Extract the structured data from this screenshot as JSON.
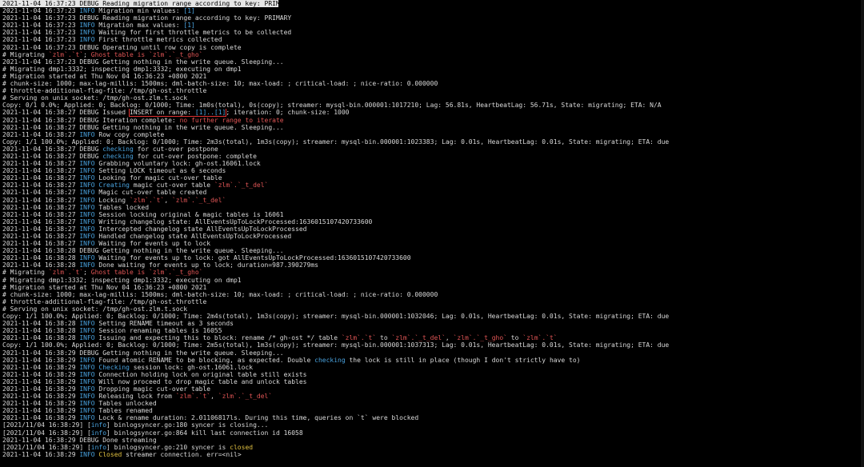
{
  "colors": {
    "background": "#000000",
    "text": "#d9d9d9",
    "info": "#4aa3df",
    "accent_red": "#e05555",
    "closed": "#e0c040"
  },
  "lines": [
    {
      "hl": true,
      "segs": [
        {
          "t": "2021-11-04 16:37:23 DEBUG Reading migration range according to key: PRIMARY"
        }
      ]
    },
    {
      "segs": [
        {
          "t": "2021-11-04 16:37:23 "
        },
        {
          "t": "INFO",
          "c": "blue"
        },
        {
          "t": " Migration min values: "
        },
        {
          "t": "[1]",
          "c": "blue"
        }
      ]
    },
    {
      "segs": [
        {
          "t": "2021-11-04 16:37:23 DEBUG Reading migration range according to key: PRIMARY"
        }
      ]
    },
    {
      "segs": [
        {
          "t": "2021-11-04 16:37:23 "
        },
        {
          "t": "INFO",
          "c": "blue"
        },
        {
          "t": " Migration max values: "
        },
        {
          "t": "[1]",
          "c": "blue"
        }
      ]
    },
    {
      "segs": [
        {
          "t": "2021-11-04 16:37:23 "
        },
        {
          "t": "INFO",
          "c": "blue"
        },
        {
          "t": " Waiting for first throttle metrics to be collected"
        }
      ]
    },
    {
      "segs": [
        {
          "t": "2021-11-04 16:37:23 "
        },
        {
          "t": "INFO",
          "c": "blue"
        },
        {
          "t": " First throttle metrics collected"
        }
      ]
    },
    {
      "segs": [
        {
          "t": "2021-11-04 16:37:23 DEBUG Operating until row copy is complete"
        }
      ]
    },
    {
      "segs": [
        {
          "t": "# Migrating "
        },
        {
          "t": "`zlm`.`t`",
          "c": "red"
        },
        {
          "t": "; "
        },
        {
          "t": "Ghost table is",
          "c": "red"
        },
        {
          "t": " "
        },
        {
          "t": "`zlm`.`_t_gho`",
          "c": "red"
        }
      ]
    },
    {
      "segs": [
        {
          "t": "2021-11-04 16:37:23 DEBUG Getting nothing in the write queue. Sleeping..."
        }
      ]
    },
    {
      "segs": [
        {
          "t": "# Migrating dmp1:3332; inspecting dmp1:3332; executing on dmp1"
        }
      ]
    },
    {
      "segs": [
        {
          "t": "# Migration started at Thu Nov 04 16:36:23 +0800 2021"
        }
      ]
    },
    {
      "segs": [
        {
          "t": "# chunk-size: 1000; max-lag-millis: 1500ms; dml-batch-size: 10; max-load: ; critical-load: ; nice-ratio: 0.000000"
        }
      ]
    },
    {
      "segs": [
        {
          "t": "# throttle-additional-flag-file: /tmp/gh-ost.throttle"
        }
      ]
    },
    {
      "segs": [
        {
          "t": "# Serving on unix socket: /tmp/gh-ost.zlm.t.sock"
        }
      ]
    },
    {
      "segs": [
        {
          "t": "Copy: 0/1 0.0%; Applied: 0; Backlog: 0/1000; Time: 1m0s(total), 0s(copy); streamer: mysql-bin.000001:1017210; Lag: 56.81s, HeartbeatLag: 56.71s, State: migrating; ETA: N/A"
        }
      ]
    },
    {
      "segs": [
        {
          "t": "2021-11-04 16:38:27 DEBUG Issued "
        },
        {
          "t": "INSERT on range: ",
          "b": true
        },
        {
          "t": "[1]..[1]",
          "c": "blue",
          "b": true
        },
        {
          "t": "; iteration: 0; chunk-size: 1000"
        }
      ]
    },
    {
      "segs": [
        {
          "t": "2021-11-04 16:38:27 DEBUG Iteration complete: "
        },
        {
          "t": "no further range to iterate",
          "c": "red"
        }
      ]
    },
    {
      "segs": [
        {
          "t": "2021-11-04 16:38:27 DEBUG Getting nothing in the write queue. Sleeping..."
        }
      ]
    },
    {
      "segs": [
        {
          "t": "2021-11-04 16:38:27 "
        },
        {
          "t": "INFO",
          "c": "blue"
        },
        {
          "t": " Row copy complete"
        }
      ]
    },
    {
      "segs": [
        {
          "t": "Copy: 1/1 100.0%; Applied: 0; Backlog: 0/1000; Time: 2m3s(total), 1m3s(copy); streamer: mysql-bin.000001:1023383; Lag: 0.01s, HeartbeatLag: 0.01s, State: migrating; ETA: due"
        }
      ]
    },
    {
      "segs": [
        {
          "t": "2021-11-04 16:38:27 DEBUG "
        },
        {
          "t": "checking",
          "c": "blue"
        },
        {
          "t": " for cut-over postpone"
        }
      ]
    },
    {
      "segs": [
        {
          "t": "2021-11-04 16:38:27 DEBUG "
        },
        {
          "t": "checking",
          "c": "blue"
        },
        {
          "t": " for cut-over postpone: complete"
        }
      ]
    },
    {
      "segs": [
        {
          "t": "2021-11-04 16:38:27 "
        },
        {
          "t": "INFO",
          "c": "blue"
        },
        {
          "t": " Grabbing voluntary lock: gh-ost.16061.lock"
        }
      ]
    },
    {
      "segs": [
        {
          "t": "2021-11-04 16:38:27 "
        },
        {
          "t": "INFO",
          "c": "blue"
        },
        {
          "t": " Setting LOCK timeout as 6 seconds"
        }
      ]
    },
    {
      "segs": [
        {
          "t": "2021-11-04 16:38:27 "
        },
        {
          "t": "INFO",
          "c": "blue"
        },
        {
          "t": " Looking for magic cut-over table"
        }
      ]
    },
    {
      "segs": [
        {
          "t": "2021-11-04 16:38:27 "
        },
        {
          "t": "INFO",
          "c": "blue"
        },
        {
          "t": " "
        },
        {
          "t": "Creating",
          "c": "blue"
        },
        {
          "t": " magic cut-over table "
        },
        {
          "t": "`zlm`.`_t_del`",
          "c": "red"
        }
      ]
    },
    {
      "segs": [
        {
          "t": "2021-11-04 16:38:27 "
        },
        {
          "t": "INFO",
          "c": "blue"
        },
        {
          "t": " Magic cut-over table created"
        }
      ]
    },
    {
      "segs": [
        {
          "t": "2021-11-04 16:38:27 "
        },
        {
          "t": "INFO",
          "c": "blue"
        },
        {
          "t": " Locking "
        },
        {
          "t": "`zlm`.`t`",
          "c": "red"
        },
        {
          "t": ", "
        },
        {
          "t": "`zlm`.`_t_del`",
          "c": "red"
        }
      ]
    },
    {
      "segs": [
        {
          "t": "2021-11-04 16:38:27 "
        },
        {
          "t": "INFO",
          "c": "blue"
        },
        {
          "t": " Tables locked"
        }
      ]
    },
    {
      "segs": [
        {
          "t": "2021-11-04 16:38:27 "
        },
        {
          "t": "INFO",
          "c": "blue"
        },
        {
          "t": " Session locking original & magic tables is 16061"
        }
      ]
    },
    {
      "segs": [
        {
          "t": "2021-11-04 16:38:27 "
        },
        {
          "t": "INFO",
          "c": "blue"
        },
        {
          "t": " Writing changelog state: AllEventsUpToLockProcessed:1636015107420733600"
        }
      ]
    },
    {
      "segs": [
        {
          "t": "2021-11-04 16:38:27 "
        },
        {
          "t": "INFO",
          "c": "blue"
        },
        {
          "t": " Intercepted changelog state AllEventsUpToLockProcessed"
        }
      ]
    },
    {
      "segs": [
        {
          "t": "2021-11-04 16:38:27 "
        },
        {
          "t": "INFO",
          "c": "blue"
        },
        {
          "t": " Handled changelog state AllEventsUpToLockProcessed"
        }
      ]
    },
    {
      "segs": [
        {
          "t": "2021-11-04 16:38:27 "
        },
        {
          "t": "INFO",
          "c": "blue"
        },
        {
          "t": " Waiting for events up to lock"
        }
      ]
    },
    {
      "segs": [
        {
          "t": "2021-11-04 16:38:28 DEBUG Getting nothing in the write queue. Sleeping..."
        }
      ]
    },
    {
      "segs": [
        {
          "t": "2021-11-04 16:38:28 "
        },
        {
          "t": "INFO",
          "c": "blue"
        },
        {
          "t": " Waiting for events up to lock: got AllEventsUpToLockProcessed:1636015107420733600"
        }
      ]
    },
    {
      "segs": [
        {
          "t": "2021-11-04 16:38:28 "
        },
        {
          "t": "INFO",
          "c": "blue"
        },
        {
          "t": " Done waiting for events up to lock; duration=987.390279ms"
        }
      ]
    },
    {
      "segs": [
        {
          "t": "# Migrating "
        },
        {
          "t": "`zlm`.`t`",
          "c": "red"
        },
        {
          "t": "; "
        },
        {
          "t": "Ghost table is",
          "c": "red"
        },
        {
          "t": " "
        },
        {
          "t": "`zlm`.`_t_gho`",
          "c": "red"
        }
      ]
    },
    {
      "segs": [
        {
          "t": "# Migrating dmp1:3332; inspecting dmp1:3332; executing on dmp1"
        }
      ]
    },
    {
      "segs": [
        {
          "t": "# Migration started at Thu Nov 04 16:36:23 +0800 2021"
        }
      ]
    },
    {
      "segs": [
        {
          "t": "# chunk-size: 1000; max-lag-millis: 1500ms; dml-batch-size: 10; max-load: ; critical-load: ; nice-ratio: 0.000000"
        }
      ]
    },
    {
      "segs": [
        {
          "t": "# throttle-additional-flag-file: /tmp/gh-ost.throttle"
        }
      ]
    },
    {
      "segs": [
        {
          "t": "# Serving on unix socket: /tmp/gh-ost.zlm.t.sock"
        }
      ]
    },
    {
      "segs": [
        {
          "t": "Copy: 1/1 100.0%; Applied: 0; Backlog: 0/1000; Time: 2m4s(total), 1m3s(copy); streamer: mysql-bin.000001:1032046; Lag: 0.01s, HeartbeatLag: 0.01s, State: migrating; ETA: due"
        }
      ]
    },
    {
      "segs": [
        {
          "t": "2021-11-04 16:38:28 "
        },
        {
          "t": "INFO",
          "c": "blue"
        },
        {
          "t": " Setting RENAME timeout as 3 seconds"
        }
      ]
    },
    {
      "segs": [
        {
          "t": "2021-11-04 16:38:28 "
        },
        {
          "t": "INFO",
          "c": "blue"
        },
        {
          "t": " Session renaming tables is 16055"
        }
      ]
    },
    {
      "segs": [
        {
          "t": "2021-11-04 16:38:28 "
        },
        {
          "t": "INFO",
          "c": "blue"
        },
        {
          "t": " Issuing and expecting this to block: rename /* gh-ost */ table "
        },
        {
          "t": "`zlm`.`t`",
          "c": "red"
        },
        {
          "t": " to "
        },
        {
          "t": "`zlm`.`_t_del`",
          "c": "red"
        },
        {
          "t": ", "
        },
        {
          "t": "`zlm`.`_t_gho`",
          "c": "red"
        },
        {
          "t": " to "
        },
        {
          "t": "`zlm`.`t`",
          "c": "red"
        }
      ]
    },
    {
      "segs": [
        {
          "t": "Copy: 1/1 100.0%; Applied: 0; Backlog: 0/1000; Time: 2m5s(total), 1m3s(copy); streamer: mysql-bin.000001:1037313; Lag: 0.01s, HeartbeatLag: 0.01s, State: migrating; ETA: due"
        }
      ]
    },
    {
      "segs": [
        {
          "t": "2021-11-04 16:38:29 DEBUG Getting nothing in the write queue. Sleeping..."
        }
      ]
    },
    {
      "segs": [
        {
          "t": "2021-11-04 16:38:29 "
        },
        {
          "t": "INFO",
          "c": "blue"
        },
        {
          "t": " Found atomic RENAME to be blocking, as expected. Double "
        },
        {
          "t": "checking",
          "c": "blue"
        },
        {
          "t": " the lock is still in place (though I don't strictly have to)"
        }
      ]
    },
    {
      "segs": [
        {
          "t": "2021-11-04 16:38:29 "
        },
        {
          "t": "INFO",
          "c": "blue"
        },
        {
          "t": " "
        },
        {
          "t": "Checking",
          "c": "blue"
        },
        {
          "t": " session lock: gh-ost.16061.lock"
        }
      ]
    },
    {
      "segs": [
        {
          "t": "2021-11-04 16:38:29 "
        },
        {
          "t": "INFO",
          "c": "blue"
        },
        {
          "t": " Connection holding lock on original table still exists"
        }
      ]
    },
    {
      "segs": [
        {
          "t": "2021-11-04 16:38:29 "
        },
        {
          "t": "INFO",
          "c": "blue"
        },
        {
          "t": " Will now proceed to drop magic table and unlock tables"
        }
      ]
    },
    {
      "segs": [
        {
          "t": "2021-11-04 16:38:29 "
        },
        {
          "t": "INFO",
          "c": "blue"
        },
        {
          "t": " Dropping magic cut-over table"
        }
      ]
    },
    {
      "segs": [
        {
          "t": "2021-11-04 16:38:29 "
        },
        {
          "t": "INFO",
          "c": "blue"
        },
        {
          "t": " Releasing lock from "
        },
        {
          "t": "`zlm`.`t`",
          "c": "red"
        },
        {
          "t": ", "
        },
        {
          "t": "`zlm`.`_t_del`",
          "c": "red"
        }
      ]
    },
    {
      "segs": [
        {
          "t": "2021-11-04 16:38:29 "
        },
        {
          "t": "INFO",
          "c": "blue"
        },
        {
          "t": " Tables unlocked"
        }
      ]
    },
    {
      "segs": [
        {
          "t": "2021-11-04 16:38:29 "
        },
        {
          "t": "INFO",
          "c": "blue"
        },
        {
          "t": " Tables renamed"
        }
      ]
    },
    {
      "segs": [
        {
          "t": "2021-11-04 16:38:29 "
        },
        {
          "t": "INFO",
          "c": "blue"
        },
        {
          "t": " Lock & rename duration: 2.01106817ls. During this time, queries on `t` were blocked"
        }
      ]
    },
    {
      "segs": [
        {
          "t": "[2021/11/04 16:38:29] ["
        },
        {
          "t": "info",
          "c": "blue"
        },
        {
          "t": "] binlogsyncer.go:180 syncer is closing..."
        }
      ]
    },
    {
      "segs": [
        {
          "t": "[2021/11/04 16:38:29] ["
        },
        {
          "t": "info",
          "c": "blue"
        },
        {
          "t": "] binlogsyncer.go:864 kill last connection id 16058"
        }
      ]
    },
    {
      "segs": [
        {
          "t": "2021-11-04 16:38:29 DEBUG Done streaming"
        }
      ]
    },
    {
      "segs": [
        {
          "t": "[2021/11/04 16:38:29] ["
        },
        {
          "t": "info",
          "c": "blue"
        },
        {
          "t": "] binlogsyncer.go:210 syncer is "
        },
        {
          "t": "closed",
          "c": "yellow"
        }
      ]
    },
    {
      "segs": [
        {
          "t": "2021-11-04 16:38:29 "
        },
        {
          "t": "INFO",
          "c": "blue"
        },
        {
          "t": " "
        },
        {
          "t": "Closed",
          "c": "yellow"
        },
        {
          "t": " streamer connection. err=<nil>"
        }
      ]
    }
  ]
}
